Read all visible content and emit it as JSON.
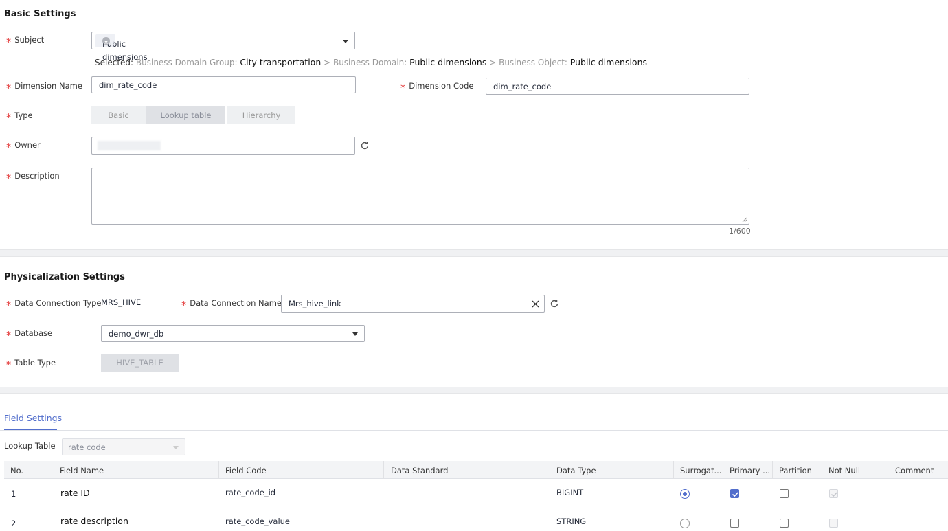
{
  "basic": {
    "title": "Basic Settings",
    "subject_label": "Subject",
    "subject_tag": "Public dimensions",
    "selected_prefix": "Selected:",
    "bdg_label": "Business Domain Group:",
    "bdg_value": "City transportation",
    "sep1": ">",
    "bd_label": "Business Domain:",
    "bd_value": "Public dimensions",
    "sep2": ">",
    "bo_label": "Business Object:",
    "bo_value": "Public dimensions",
    "dim_name_label": "Dimension Name",
    "dim_name_value": "dim_rate_code",
    "dim_code_label": "Dimension Code",
    "dim_code_value": "dim_rate_code",
    "type_label": "Type",
    "type_options": [
      "Basic",
      "Lookup table",
      "Hierarchy"
    ],
    "owner_label": "Owner",
    "description_label": "Description",
    "description_value": "",
    "char_count": "1/600"
  },
  "phys": {
    "title": "Physicalization Settings",
    "conn_type_label": "Data Connection Type",
    "conn_type_value": "MRS_HIVE",
    "conn_name_label": "Data Connection Name",
    "conn_name_value": "Mrs_hive_link",
    "database_label": "Database",
    "database_value": "demo_dwr_db",
    "table_type_label": "Table Type",
    "table_type_value": "HIVE_TABLE"
  },
  "fields": {
    "tab_label": "Field Settings",
    "lookup_label": "Lookup Table",
    "lookup_value": "rate code",
    "columns": [
      "No.",
      "Field Name",
      "Field Code",
      "Data Standard",
      "Data Type",
      "Surrogat...",
      "Primary ...",
      "Partition",
      "Not Null",
      "Comment"
    ],
    "rows": [
      {
        "no": "1",
        "name": "rate ID",
        "code": "rate_code_id",
        "standard": "",
        "type": "BIGINT",
        "surrogate": true,
        "primary": true,
        "partition": false,
        "notnull": true,
        "comment": ""
      },
      {
        "no": "2",
        "name": "rate description",
        "code": "rate_code_value",
        "standard": "",
        "type": "STRING",
        "surrogate": false,
        "primary": false,
        "partition": false,
        "notnull": false,
        "comment": ""
      }
    ]
  },
  "colors": {
    "accent": "#526ecc",
    "required": "#e54545"
  },
  "icons": {
    "refresh": "refresh-icon",
    "clear": "close-icon",
    "dropdown": "chevron-down-icon",
    "tag_remove": "tag-remove-icon"
  }
}
